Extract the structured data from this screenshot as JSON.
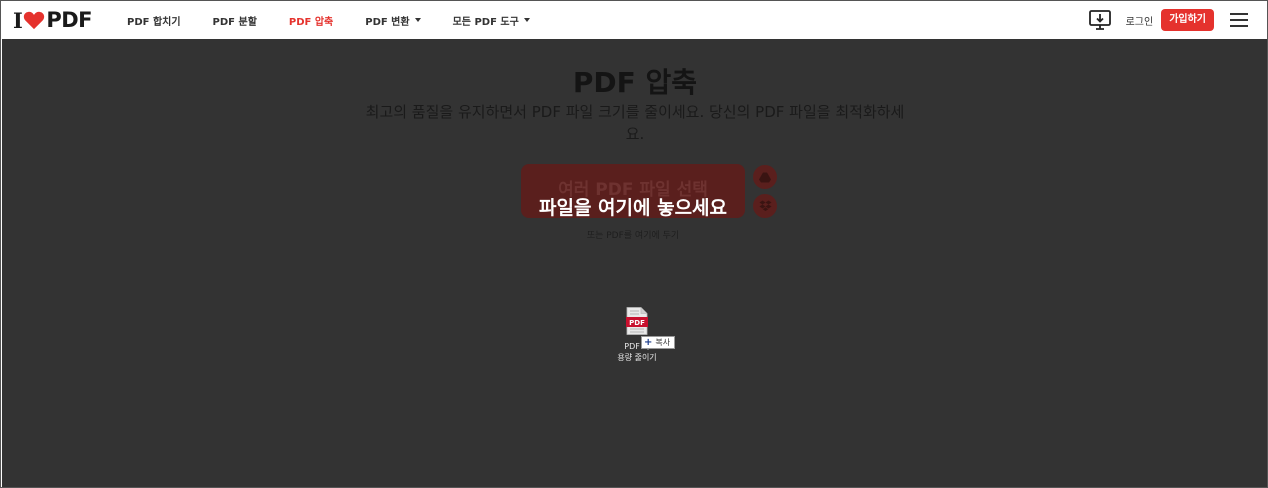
{
  "header": {
    "logo": {
      "i": "I",
      "heart": "heart-icon",
      "pdf": "PDF"
    },
    "nav": [
      {
        "label": "PDF 합치기",
        "active": false,
        "dropdown": false
      },
      {
        "label": "PDF 분할",
        "active": false,
        "dropdown": false
      },
      {
        "label": "PDF 압축",
        "active": true,
        "dropdown": false
      },
      {
        "label": "PDF 변환",
        "active": false,
        "dropdown": true
      },
      {
        "label": "모든 PDF 도구",
        "active": false,
        "dropdown": true
      }
    ],
    "login": "로그인",
    "signup": "가입하기"
  },
  "main": {
    "title": "PDF 압축",
    "subtitle": "최고의 품질을 유지하면서 PDF 파일 크기를 줄이세요. 당신의 PDF 파일을 최적화하세요.",
    "select_button": "여러 PDF 파일 선택",
    "drop_overlay": "파일을 여기에 놓으세요",
    "or_drop": "또는 PDF를 여기에 두기",
    "drag_file": {
      "label_line1": "PDF 파",
      "label_line2": "용량 줄이기",
      "badge": "PDF",
      "copy_tag": "복사"
    }
  },
  "colors": {
    "accent": "#e5322d",
    "overlay": "#333333",
    "button_dim": "#5a1f1d"
  }
}
